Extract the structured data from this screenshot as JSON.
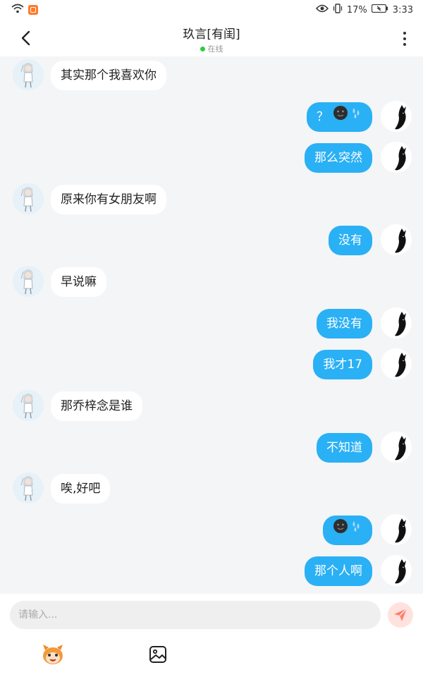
{
  "status_bar": {
    "battery": "17%",
    "time": "3:33"
  },
  "header": {
    "title": "玖言[有闺]",
    "presence": "在线"
  },
  "messages": [
    {
      "side": "left",
      "text": "其实那个我喜欢你"
    },
    {
      "side": "right",
      "text": "？",
      "emoji": true
    },
    {
      "side": "right",
      "text": "那么突然"
    },
    {
      "side": "left",
      "text": "原来你有女朋友啊"
    },
    {
      "side": "right",
      "text": "没有"
    },
    {
      "side": "left",
      "text": "早说嘛"
    },
    {
      "side": "right",
      "text": "我没有"
    },
    {
      "side": "right",
      "text": "我才17"
    },
    {
      "side": "left",
      "text": "那乔梓念是谁"
    },
    {
      "side": "right",
      "text": "不知道"
    },
    {
      "side": "left",
      "text": "唉,好吧"
    },
    {
      "side": "right",
      "text": "",
      "emoji": true
    },
    {
      "side": "right",
      "text": "那个人啊"
    }
  ],
  "input": {
    "placeholder": "请输入..."
  },
  "colors": {
    "accent": "#2ab0f5",
    "online": "#2ecc40",
    "send": "#ff7f6e"
  },
  "icons": {
    "back": "chevron-left-icon",
    "more": "more-vertical-icon",
    "send": "send-icon",
    "mascot": "mascot-sticker-icon",
    "image": "image-picker-icon"
  }
}
